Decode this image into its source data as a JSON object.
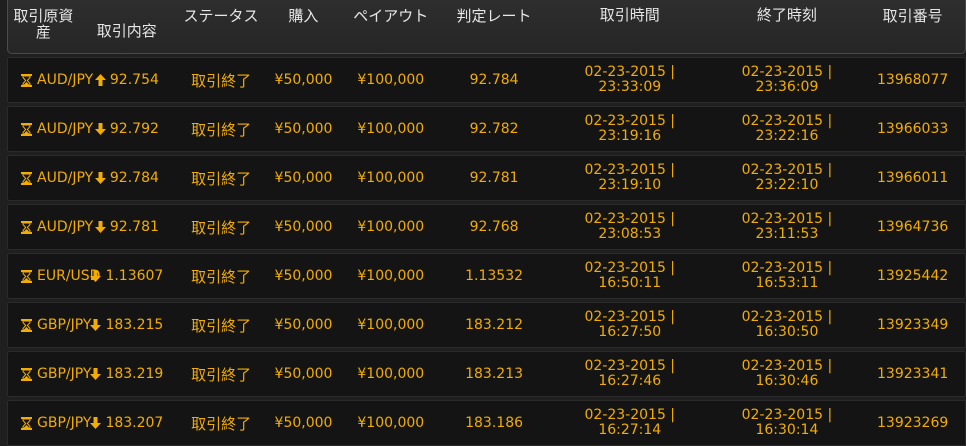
{
  "colors": {
    "background": "#1f1f1f",
    "row_background": "#141414",
    "accent": "#f2ad00",
    "header_text": "#e6e6e6"
  },
  "headers": [
    "取引原資産",
    "取引内容",
    "ステータス",
    "購入",
    "ペイアウト",
    "判定レート",
    "取引時間",
    "終了時刻",
    "取引番号"
  ],
  "rows": [
    {
      "asset": "AUD/JPY",
      "direction_icon": "arrow-up-icon",
      "direction": "up",
      "rate": "92.754",
      "status": "取引終了",
      "purchase": "¥50,000",
      "payout": "¥100,000",
      "judge_rate": "92.784",
      "trade_date": "02-23-2015 |",
      "trade_time": "23:33:09",
      "end_date": "02-23-2015 |",
      "end_time": "23:36:09",
      "trade_no": "13968077"
    },
    {
      "asset": "AUD/JPY",
      "direction_icon": "arrow-down-icon",
      "direction": "down",
      "rate": "92.792",
      "status": "取引終了",
      "purchase": "¥50,000",
      "payout": "¥100,000",
      "judge_rate": "92.782",
      "trade_date": "02-23-2015 |",
      "trade_time": "23:19:16",
      "end_date": "02-23-2015 |",
      "end_time": "23:22:16",
      "trade_no": "13966033"
    },
    {
      "asset": "AUD/JPY",
      "direction_icon": "arrow-down-icon",
      "direction": "down",
      "rate": "92.784",
      "status": "取引終了",
      "purchase": "¥50,000",
      "payout": "¥100,000",
      "judge_rate": "92.781",
      "trade_date": "02-23-2015 |",
      "trade_time": "23:19:10",
      "end_date": "02-23-2015 |",
      "end_time": "23:22:10",
      "trade_no": "13966011"
    },
    {
      "asset": "AUD/JPY",
      "direction_icon": "arrow-down-icon",
      "direction": "down",
      "rate": "92.781",
      "status": "取引終了",
      "purchase": "¥50,000",
      "payout": "¥100,000",
      "judge_rate": "92.768",
      "trade_date": "02-23-2015 |",
      "trade_time": "23:08:53",
      "end_date": "02-23-2015 |",
      "end_time": "23:11:53",
      "trade_no": "13964736"
    },
    {
      "asset": "EUR/USD",
      "direction_icon": "arrow-down-icon",
      "direction": "down",
      "rate": "1.13607",
      "status": "取引終了",
      "purchase": "¥50,000",
      "payout": "¥100,000",
      "judge_rate": "1.13532",
      "trade_date": "02-23-2015 |",
      "trade_time": "16:50:11",
      "end_date": "02-23-2015 |",
      "end_time": "16:53:11",
      "trade_no": "13925442"
    },
    {
      "asset": "GBP/JPY",
      "direction_icon": "arrow-down-icon",
      "direction": "down",
      "rate": "183.215",
      "status": "取引終了",
      "purchase": "¥50,000",
      "payout": "¥100,000",
      "judge_rate": "183.212",
      "trade_date": "02-23-2015 |",
      "trade_time": "16:27:50",
      "end_date": "02-23-2015 |",
      "end_time": "16:30:50",
      "trade_no": "13923349"
    },
    {
      "asset": "GBP/JPY",
      "direction_icon": "arrow-down-icon",
      "direction": "down",
      "rate": "183.219",
      "status": "取引終了",
      "purchase": "¥50,000",
      "payout": "¥100,000",
      "judge_rate": "183.213",
      "trade_date": "02-23-2015 |",
      "trade_time": "16:27:46",
      "end_date": "02-23-2015 |",
      "end_time": "16:30:46",
      "trade_no": "13923341"
    },
    {
      "asset": "GBP/JPY",
      "direction_icon": "arrow-down-icon",
      "direction": "down",
      "rate": "183.207",
      "status": "取引終了",
      "purchase": "¥50,000",
      "payout": "¥100,000",
      "judge_rate": "183.186",
      "trade_date": "02-23-2015 |",
      "trade_time": "16:27:14",
      "end_date": "02-23-2015 |",
      "end_time": "16:30:14",
      "trade_no": "13923269"
    }
  ]
}
